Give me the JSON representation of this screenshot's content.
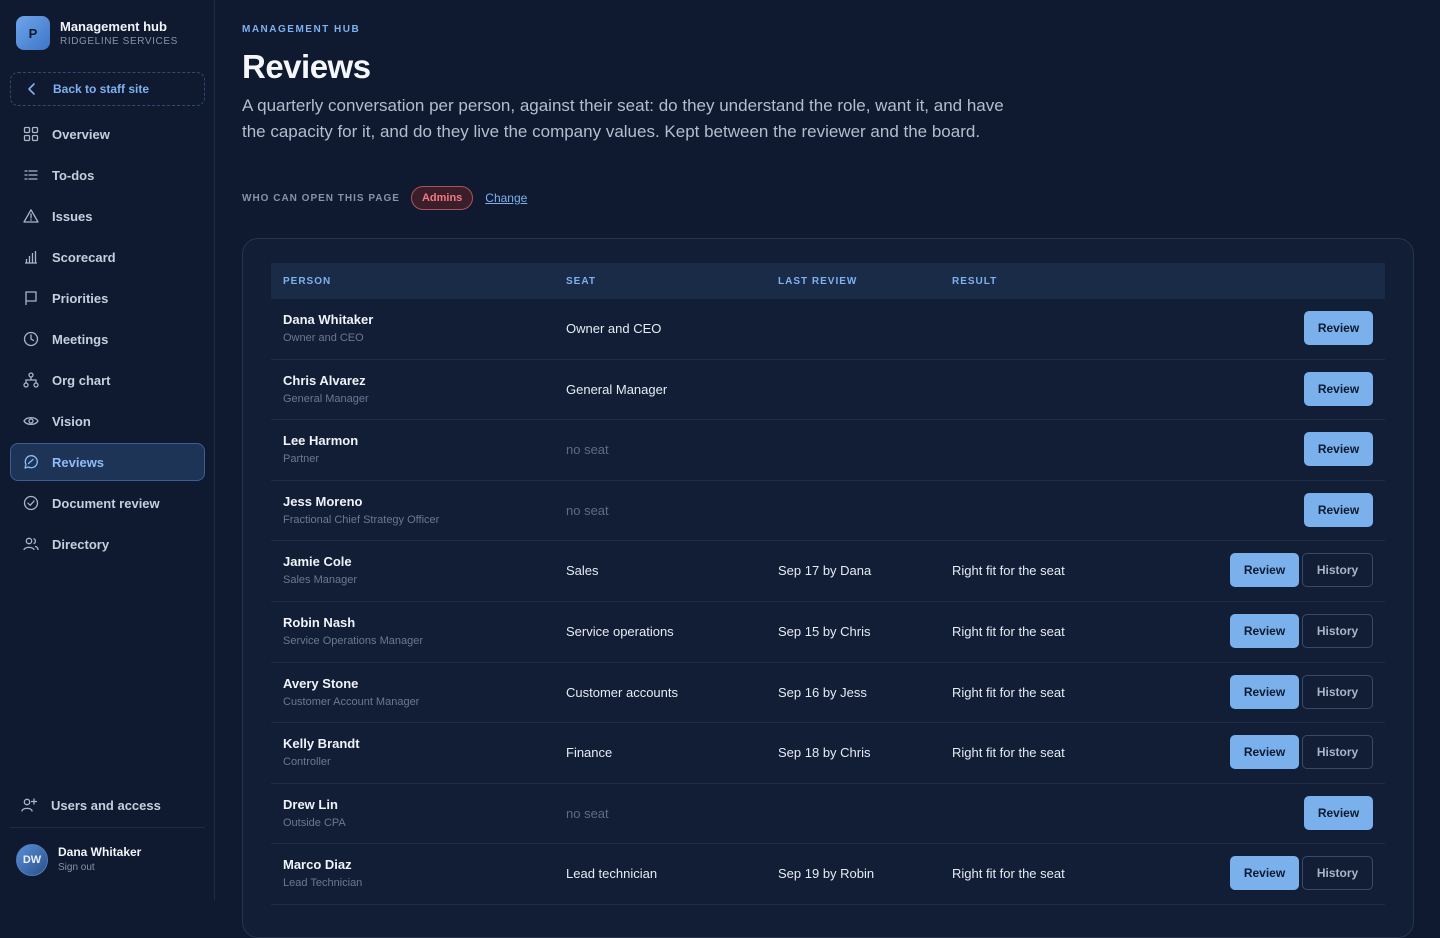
{
  "brand": {
    "logo_letter": "P",
    "title": "Management hub",
    "subtitle": "RIDGELINE SERVICES"
  },
  "sidebar": {
    "back_label": "Back to staff site",
    "items": [
      {
        "label": "Overview",
        "icon": "grid-icon"
      },
      {
        "label": "To-dos",
        "icon": "checklist-icon"
      },
      {
        "label": "Issues",
        "icon": "warning-icon"
      },
      {
        "label": "Scorecard",
        "icon": "bar-chart-icon"
      },
      {
        "label": "Priorities",
        "icon": "flag-icon"
      },
      {
        "label": "Meetings",
        "icon": "clock-icon"
      },
      {
        "label": "Org chart",
        "icon": "org-chart-icon"
      },
      {
        "label": "Vision",
        "icon": "eye-icon"
      },
      {
        "label": "Reviews",
        "icon": "chat-icon",
        "active": true
      },
      {
        "label": "Document review",
        "icon": "check-circle-icon"
      },
      {
        "label": "Directory",
        "icon": "people-icon"
      }
    ],
    "users_label": "Users and access",
    "user": {
      "initials": "DW",
      "name": "Dana Whitaker",
      "action": "Sign out"
    }
  },
  "header": {
    "eyebrow": "MANAGEMENT HUB",
    "title": "Reviews",
    "intro": "A quarterly conversation per person, against their seat: do they understand the role, want it, and have the capacity for it, and do they live the company values. Kept between the reviewer and the board.",
    "access_label": "WHO CAN OPEN THIS PAGE",
    "access_badge": "Admins",
    "change_label": "Change"
  },
  "table": {
    "columns": [
      "PERSON",
      "SEAT",
      "LAST REVIEW",
      "RESULT"
    ],
    "review_label": "Review",
    "history_label": "History",
    "rows": [
      {
        "name": "Dana Whitaker",
        "title": "Owner and CEO",
        "seat": "Owner and CEO",
        "seat_muted": false,
        "last": "",
        "result": "",
        "history": false
      },
      {
        "name": "Chris Alvarez",
        "title": "General Manager",
        "seat": "General Manager",
        "seat_muted": false,
        "last": "",
        "result": "",
        "history": false
      },
      {
        "name": "Lee Harmon",
        "title": "Partner",
        "seat": "no seat",
        "seat_muted": true,
        "last": "",
        "result": "",
        "history": false
      },
      {
        "name": "Jess Moreno",
        "title": "Fractional Chief Strategy Officer",
        "seat": "no seat",
        "seat_muted": true,
        "last": "",
        "result": "",
        "history": false
      },
      {
        "name": "Jamie Cole",
        "title": "Sales Manager",
        "seat": "Sales",
        "seat_muted": false,
        "last": "Sep 17 by Dana",
        "result": "Right fit for the seat",
        "history": true
      },
      {
        "name": "Robin Nash",
        "title": "Service Operations Manager",
        "seat": "Service operations",
        "seat_muted": false,
        "last": "Sep 15 by Chris",
        "result": "Right fit for the seat",
        "history": true
      },
      {
        "name": "Avery Stone",
        "title": "Customer Account Manager",
        "seat": "Customer accounts",
        "seat_muted": false,
        "last": "Sep 16 by Jess",
        "result": "Right fit for the seat",
        "history": true
      },
      {
        "name": "Kelly Brandt",
        "title": "Controller",
        "seat": "Finance",
        "seat_muted": false,
        "last": "Sep 18 by Chris",
        "result": "Right fit for the seat",
        "history": true
      },
      {
        "name": "Drew Lin",
        "title": "Outside CPA",
        "seat": "no seat",
        "seat_muted": true,
        "last": "",
        "result": "",
        "history": false
      },
      {
        "name": "Marco Diaz",
        "title": "Lead Technician",
        "seat": "Lead technician",
        "seat_muted": false,
        "last": "Sep 19 by Robin",
        "result": "Right fit for the seat",
        "history": true
      }
    ]
  },
  "colors": {
    "accent": "#7ab0ec",
    "background": "#0f1a30",
    "admin_badge": "#f07a84"
  }
}
